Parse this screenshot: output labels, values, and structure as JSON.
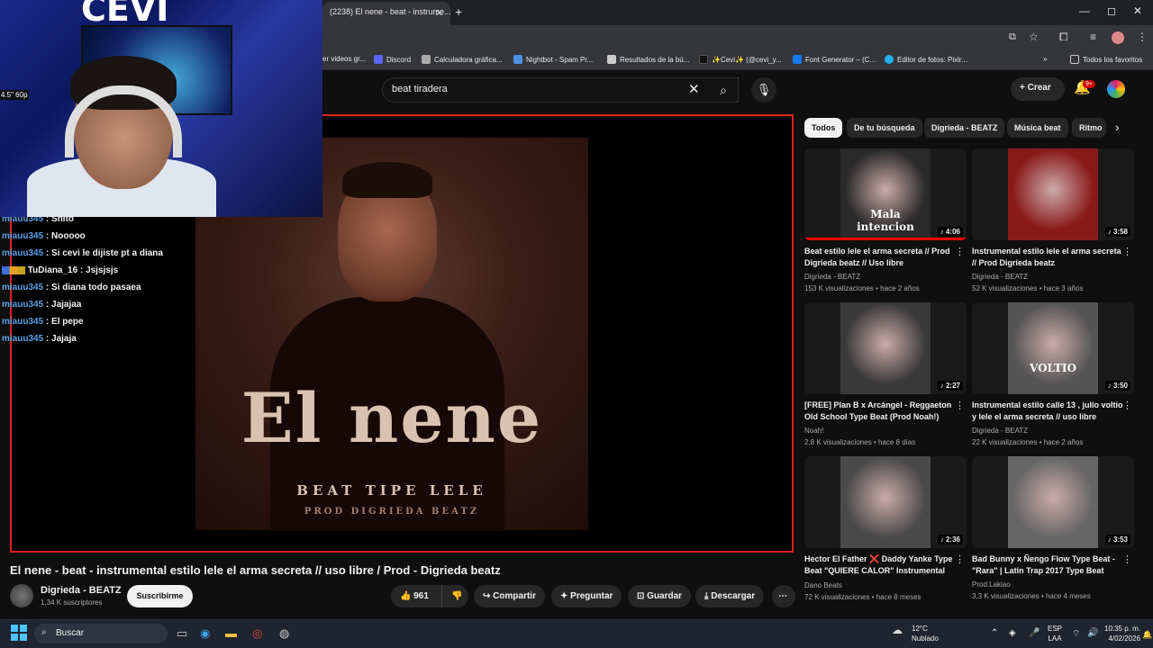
{
  "browser": {
    "tab_title": "(2238) El nene - beat - instrume...",
    "tab_close": "✕",
    "new_tab": "+",
    "window_controls": [
      "—",
      "◻",
      "✕"
    ],
    "bookmarks": [
      {
        "label": "er videos gr...",
        "color": "#888"
      },
      {
        "label": "Discord",
        "color": "#5865f2"
      },
      {
        "label": "Calculadora gráfica...",
        "color": "#aaa"
      },
      {
        "label": "Nightbot - Spam Pr...",
        "color": "#4a90e2"
      },
      {
        "label": "Resultados de la bú...",
        "color": "#ccc"
      },
      {
        "label": "✨Cevi✨ (@cevi_y...",
        "color": "#111"
      },
      {
        "label": "Font Generator – (C...",
        "color": "#1877f2"
      },
      {
        "label": "Editor de fotos: Pixlr...",
        "color": "#23b0e8"
      }
    ],
    "all_favorites": "Todos los favoritos"
  },
  "youtube": {
    "search_value": "beat tiradera",
    "create_label": "Crear",
    "notif_badge": "9+",
    "chips": [
      "Todos",
      "De tu búsqueda",
      "Digrieda - BEATZ",
      "Música beat",
      "Ritmo"
    ]
  },
  "video": {
    "art_title": "El nene",
    "art_subtitle": "BEAT TIPE LELE",
    "art_prod": "PROD DIGRIEDA BEATZ",
    "title": "El nene - beat - instrumental estilo lele el arma secreta // uso libre / Prod - Digrieda beatz",
    "channel": "Digrieda - BEATZ",
    "subscribers": "1,34 K suscriptores",
    "subscribe_label": "Suscribirme",
    "likes": "961",
    "share_label": "Compartir",
    "ask_label": "Preguntar",
    "save_label": "Guardar",
    "download_label": "Descargar"
  },
  "chat": [
    {
      "user": "miauu345",
      "msg": "Shito"
    },
    {
      "user": "miauu345",
      "msg": "Nooooo"
    },
    {
      "user": "miauu345",
      "msg": "Si cevi le dijiste pt a diana"
    },
    {
      "user": "TuDiana_16",
      "msg": "Jsjsjsjs"
    },
    {
      "user": "miauu345",
      "msg": "Si diana todo pasaea"
    },
    {
      "user": "miauu345",
      "msg": "Jajajaa"
    },
    {
      "user": "miauu345",
      "msg": "El pepe"
    },
    {
      "user": "miauu345",
      "msg": "Jajaja"
    }
  ],
  "webcam": {
    "overlay_text": "CEVI",
    "fps_text": "4.5\" 60p"
  },
  "recommendations": [
    {
      "title": "Beat estilo lele el arma secreta // Prod Digrieda beatz // Uso libre",
      "channel": "Digrieda - BEATZ",
      "meta": "153 K visualizaciones • hace 2 años",
      "duration": "4:06",
      "thumb_label": "Mala intencion",
      "thumb_color": "#2a2a2a",
      "progress": 1.0
    },
    {
      "title": "Instrumental estilo lele el arma secreta // Prod Digrieda beatz",
      "channel": "Digrieda - BEATZ",
      "meta": "52 K visualizaciones • hace 3 años",
      "duration": "3:58",
      "thumb_label": "",
      "thumb_color": "#8a1a1a",
      "progress": 0
    },
    {
      "title": "[FREE]  Plan B x Arcángel - Reggaeton Old School Type Beat (Prod Noah!)",
      "channel": "Noah!",
      "meta": "2,8 K visualizaciones • hace 8 días",
      "duration": "2:27",
      "thumb_label": "",
      "thumb_color": "#3a3a3a",
      "progress": 0
    },
    {
      "title": "Instrumental estilo calle 13 , julio voltio y lele el arma secreta // uso libre",
      "channel": "Digrieda - BEATZ",
      "meta": "22 K visualizaciones • hace 2 años",
      "duration": "3:50",
      "thumb_label": "VOLTIO",
      "thumb_color": "#555",
      "progress": 0
    },
    {
      "title": "Hector El Father ❌ Daddy Yanke Type Beat \"QUIERE CALOR\" Instrumental D...",
      "channel": "Dano Beats",
      "meta": "72 K visualizaciones • hace 8 meses",
      "duration": "2:36",
      "thumb_label": "",
      "thumb_color": "#4a4a4a",
      "progress": 0
    },
    {
      "title": "Bad Bunny x Ñengo Flow Type Beat - \"Rara\" | Latin Trap 2017 Type Beat",
      "channel": "Prod.Lakiao",
      "meta": "3,3 K visualizaciones • hace 4 meses",
      "duration": "3:53",
      "thumb_label": "",
      "thumb_color": "#666",
      "progress": 0
    }
  ],
  "taskbar": {
    "search_label": "Buscar",
    "weather_temp": "12°C",
    "weather_desc": "Nublado",
    "lang_top": "ESP",
    "lang_bottom": "LAA",
    "time": "10:35 p. m.",
    "date": "4/02/2026"
  }
}
